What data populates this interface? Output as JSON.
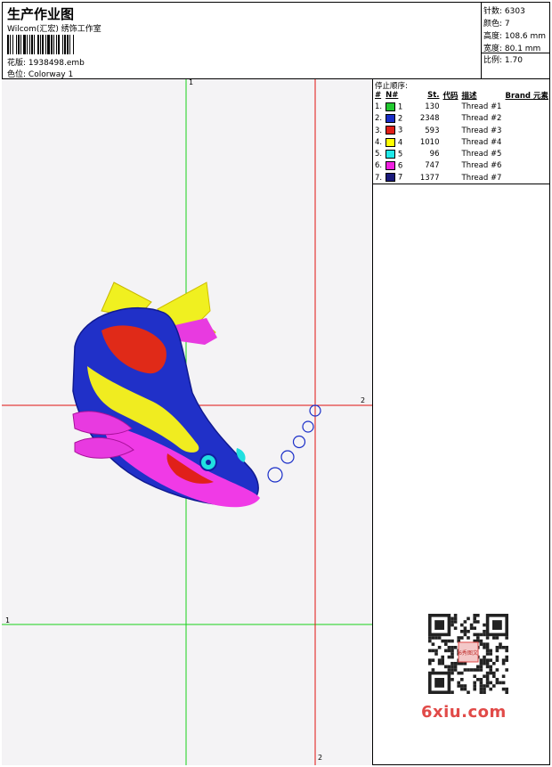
{
  "header": {
    "title": "生产作业图",
    "subtitle": "Wilcom(汇宏) 绣饰工作室",
    "design_label": "花版:",
    "design_value": "1938498.emb",
    "colorway_label": "色位:",
    "colorway_value": "Colorway 1"
  },
  "stats": {
    "stitches": "针数: 6303",
    "colors": "颜色: 7",
    "height": "高度: 108.6 mm",
    "width": "宽度: 80.1 mm",
    "scale": "比例: 1.70"
  },
  "guides": {
    "top_green": "1",
    "right_red": "2",
    "left_green": "1",
    "bottom_red": "2"
  },
  "thread_table": {
    "heading": "停止顺序:",
    "columns": [
      "#",
      "N#",
      "St.",
      "代码",
      "描述",
      "Brand",
      "元素"
    ],
    "rows": [
      {
        "n": "1.",
        "code": "1",
        "color": "#22c830",
        "stitches": "130",
        "desc": "Thread #1"
      },
      {
        "n": "2.",
        "code": "2",
        "color": "#1a2ec8",
        "stitches": "2348",
        "desc": "Thread #2"
      },
      {
        "n": "3.",
        "code": "3",
        "color": "#e01f18",
        "stitches": "593",
        "desc": "Thread #3"
      },
      {
        "n": "4.",
        "code": "4",
        "color": "#ffff00",
        "stitches": "1010",
        "desc": "Thread #4"
      },
      {
        "n": "5.",
        "code": "5",
        "color": "#20e8e8",
        "stitches": "96",
        "desc": "Thread #5"
      },
      {
        "n": "6.",
        "code": "6",
        "color": "#f020e0",
        "stitches": "747",
        "desc": "Thread #6"
      },
      {
        "n": "7.",
        "code": "7",
        "color": "#1a1a7a",
        "stitches": "1377",
        "desc": "Thread #7"
      }
    ]
  },
  "watermark": {
    "text": "6xiu.com",
    "qr_label": "6秀图文"
  }
}
